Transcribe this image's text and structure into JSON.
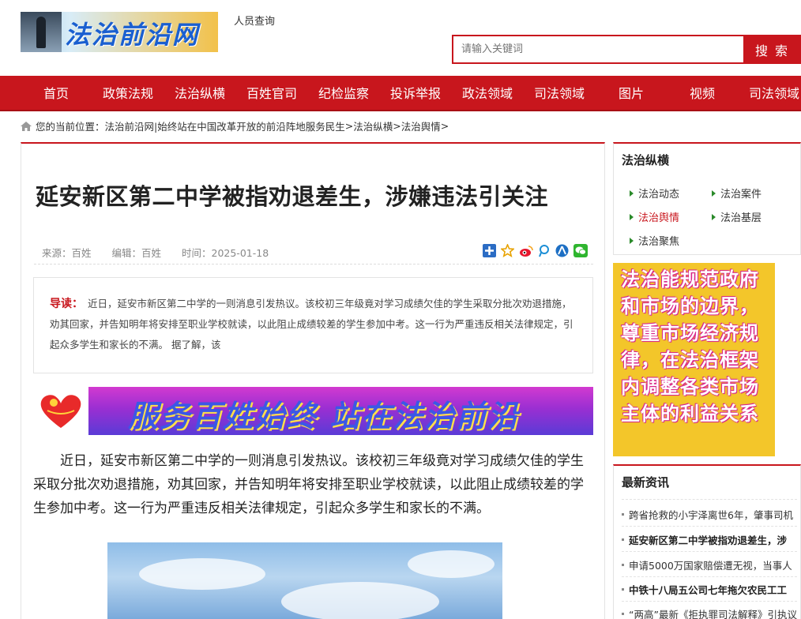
{
  "header": {
    "logo_text": "法治前沿网",
    "top_link": "人员查询",
    "search": {
      "placeholder": "请输入关键词",
      "button_label": "搜 索"
    }
  },
  "nav": {
    "items": [
      "首页",
      "政策法规",
      "法治纵横",
      "百姓官司",
      "纪检监察",
      "投诉举报",
      "政法领域",
      "司法领域",
      "图片",
      "视频",
      "司法领域"
    ]
  },
  "breadcrumb": {
    "prefix": "您的当前位置：",
    "site": "法治前沿网|始终站在中国改革开放的前沿阵地服务民生",
    "sep1": " > ",
    "level1": "法治纵横",
    "sep2": " > ",
    "level2": "法治舆情",
    "sep3": " >"
  },
  "article": {
    "title": "延安新区第二中学被指劝退差生，涉嫌违法引关注",
    "source": "来源：百姓",
    "editor": "编辑：百姓",
    "time": "时间：2025-01-18",
    "summary_label": "导读：",
    "summary_text": "近日，延安市新区第二中学的一则消息引发热议。该校初三年级竟对学习成绩欠佳的学生采取分批次劝退措施，劝其回家，并告知明年将安排至职业学校就读，以此阻止成绩较差的学生参加中考。这一行为严重违反相关法律规定，引起众多学生和家长的不满。 据了解，该",
    "banner_text": "服务百姓始终  站在法治前沿",
    "body": "近日，延安市新区第二中学的一则消息引发热议。该校初三年级竟对学习成绩欠佳的学生采取分批次劝退措施，劝其回家，并告知明年将安排至职业学校就读，以此阻止成绩较差的学生参加中考。这一行为严重违反相关法律规定，引起众多学生和家长的不满。"
  },
  "sidebar": {
    "category_title": "法治纵横",
    "categories": [
      "法治动态",
      "法治案件",
      "法治舆情",
      "法治基层",
      "法治聚焦"
    ],
    "ad_text": "法治能规范政府和市场的边界，尊重市场经济规律，在法治框架内调整各类市场主体的利益关系",
    "news_title": "最新资讯",
    "news": [
      "跨省抢救的小宇泽离世6年，肇事司机",
      "延安新区第二中学被指劝退差生，涉",
      "申请5000万国家赔偿遭无视，当事人",
      "中铁十八局五公司七年拖欠农民工工",
      "“两高”最新《拒执罪司法解释》引执议"
    ]
  },
  "colors": {
    "brand_red": "#c8161d",
    "link_active": "#c8161d",
    "bullet_green": "#2a8a2a"
  }
}
